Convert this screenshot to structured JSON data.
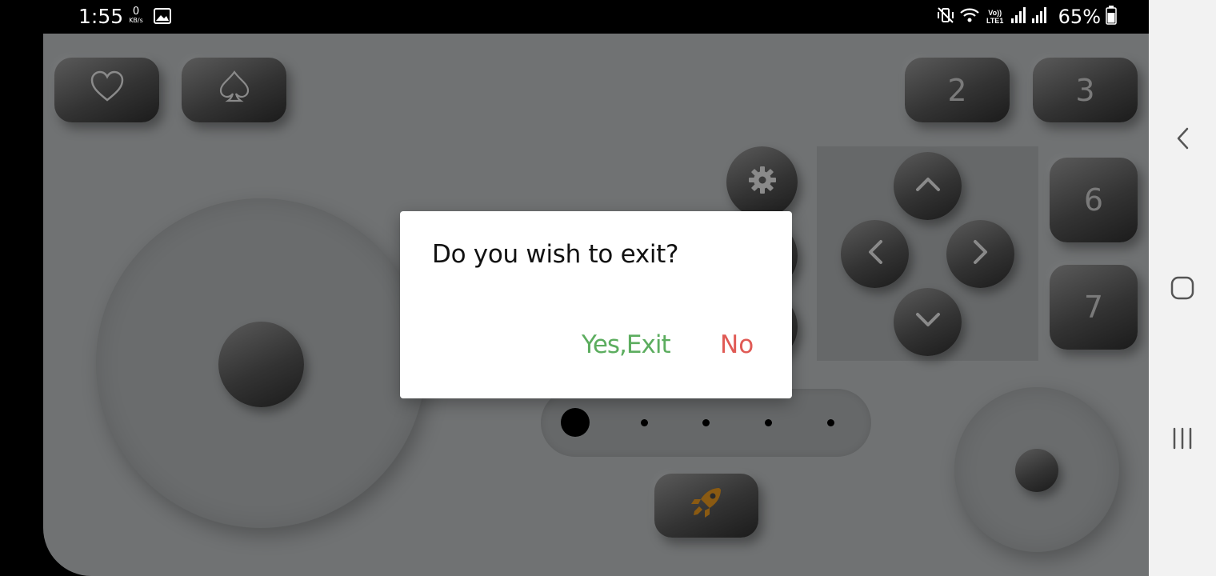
{
  "status_bar": {
    "time": "1:55",
    "net_speed_value": "0",
    "net_speed_unit": "KB/s",
    "volte_label": "Vo)) LTE1",
    "battery_percent": "65%"
  },
  "keys": {
    "top_left_1_icon": "heart-outline-icon",
    "top_left_2_icon": "spade-outline-icon",
    "key_2": "2",
    "key_3": "3",
    "key_6": "6",
    "key_7": "7",
    "settings_icon": "gear-icon",
    "rocket_icon": "rocket-icon"
  },
  "slider": {
    "positions": 5,
    "selected_index": 0
  },
  "dialog": {
    "message": "Do you wish to exit?",
    "confirm_label": "Yes,Exit",
    "cancel_label": "No"
  },
  "colors": {
    "confirm": "#5cad5f",
    "cancel": "#e05a55",
    "rocket": "#8a5a12"
  }
}
